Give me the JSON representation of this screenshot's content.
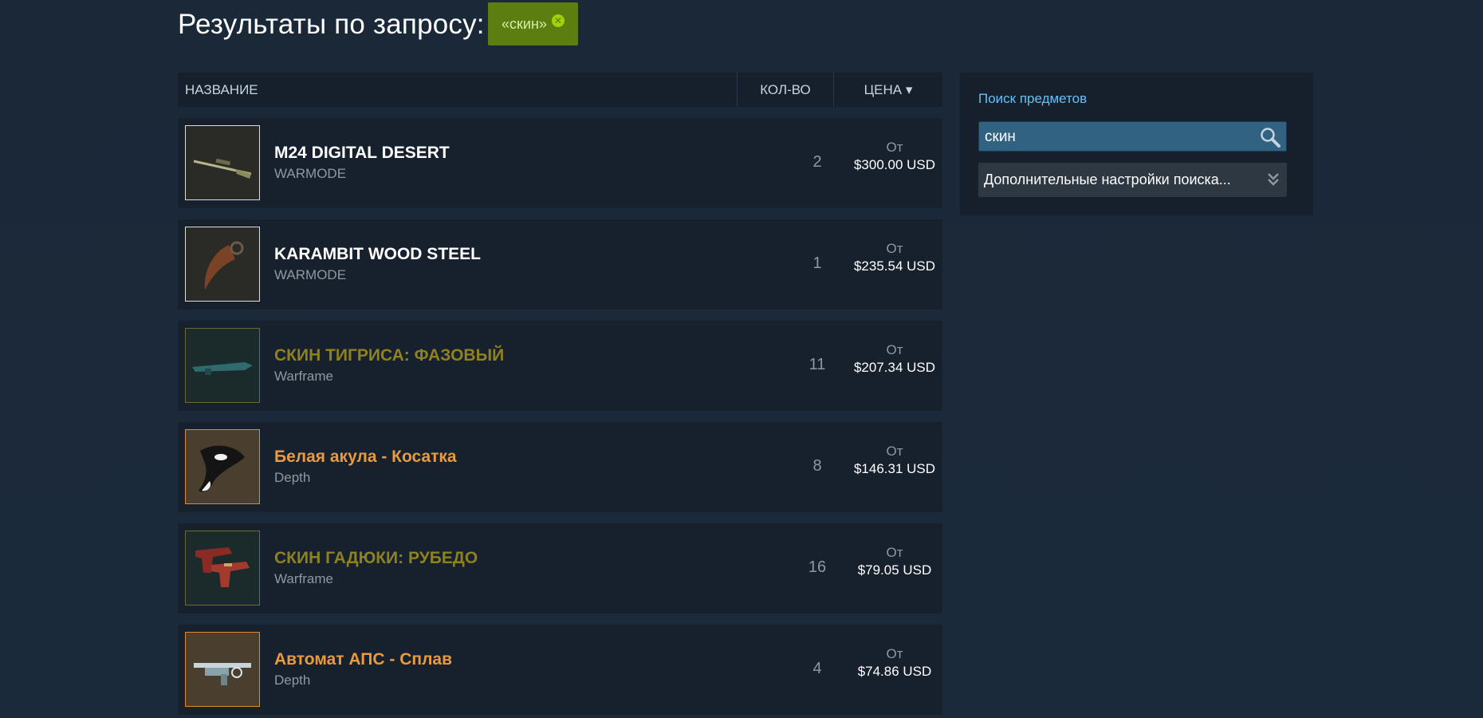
{
  "header": {
    "title": "Результаты по запросу:",
    "tag_label": "«скин»"
  },
  "table": {
    "col_name": "НАЗВАНИЕ",
    "col_qty": "КОЛ-ВО",
    "col_price": "ЦЕНА ▾"
  },
  "items": [
    {
      "name": "M24 DIGITAL DESERT",
      "game": "WARMODE",
      "qty": "2",
      "from": "От",
      "price": "$300.00 USD",
      "name_color": "#ffffff",
      "thumb": "rifle-thumbnail"
    },
    {
      "name": "KARAMBIT WOOD STEEL",
      "game": "WARMODE",
      "qty": "1",
      "from": "От",
      "price": "$235.54 USD",
      "name_color": "#ffffff",
      "thumb": "karambit-thumbnail"
    },
    {
      "name": "СКИН ТИГРИСА: ФАЗОВЫЙ",
      "game": "Warframe",
      "qty": "11",
      "from": "От",
      "price": "$207.34 USD",
      "name_color": "#8d8120",
      "thumb": "shotgun-thumbnail"
    },
    {
      "name": "Белая акула - Косатка",
      "game": "Depth",
      "qty": "8",
      "from": "От",
      "price": "$146.31 USD",
      "name_color": "#ea9a3e",
      "thumb": "orca-thumbnail"
    },
    {
      "name": "СКИН ГАДЮКИ: РУБЕДО",
      "game": "Warframe",
      "qty": "16",
      "from": "От",
      "price": "$79.05 USD",
      "name_color": "#8d8120",
      "thumb": "pistols-thumbnail"
    },
    {
      "name": "Автомат АПС - Сплав",
      "game": "Depth",
      "qty": "4",
      "from": "От",
      "price": "$74.86 USD",
      "name_color": "#ea9a3e",
      "thumb": "speargun-thumbnail"
    }
  ],
  "sidebar": {
    "title": "Поиск предметов",
    "search_value": "скин",
    "advanced_label": "Дополнительные настройки поиска..."
  }
}
